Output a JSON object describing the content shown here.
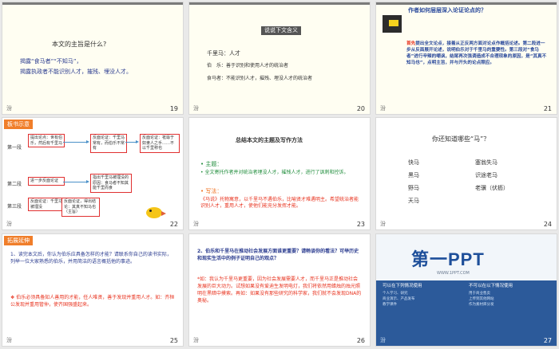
{
  "slides": [
    {
      "num": "19",
      "foot": "汾",
      "title": "本文的主旨是什么?",
      "lines": [
        "揭露“食马者”“不知马”，",
        "揭露执政者不能识别人才，摧残、埋没人才。"
      ]
    },
    {
      "num": "20",
      "foot": "汾",
      "title": "说说下文含义",
      "lines": [
        "千里马：人才",
        "伯　乐：善于识别和使用人才的统治者",
        "食马者：不能识别人才，摧残、埋没人才的统治者"
      ]
    },
    {
      "num": "21",
      "foot": "汾",
      "title": "作者如何层层深入论证论点的？",
      "body_lead": "首先",
      "body": "提出全文论点，接着从正反两方面对论点作概括论述。第二段进一步从反面展开论述，说明伯乐对于千里马的重要性。第三段对“食马者”进行辛辣的嘲讽，结尾再次强调造成不合理现象的原因，是“其真不知马也”，点明主旨，并与开头的论点照应。"
    },
    {
      "num": "22",
      "foot": "汾",
      "tag": "板书示意",
      "rows": [
        "第一段",
        "第二段",
        "第三段"
      ],
      "boxes": [
        "提出论点：世有伯乐，然后有千里马",
        "反面论证：千里马常有，而伯乐不常有",
        "反面论证：祇辱于奴隶人之手……不以千里称也",
        "进一步反面论证",
        "指出千里马被埋没的原因：食马者不知其能千里而食",
        "反面论证：千里马被埋没",
        "反面论证，得出结论：其真不知马也（主旨）"
      ]
    },
    {
      "num": "23",
      "foot": "汾",
      "title": "总结本文的主题及写作方法",
      "l1": "主题：",
      "l2": "全文寄托作者并对统治者埋没人才，摧残人才，进行了讽刺和控诉。",
      "l3": "写法：",
      "l4_lead": "《马说》托物寓意，",
      "l4": "以千里马不遇伯乐，比喻贤才难遇明主。希望统治者能识别人才，重用人才，使他们能充分发挥才能。"
    },
    {
      "num": "24",
      "foot": "汾",
      "title": "你还知道哪些“马”？",
      "col1": [
        "快马",
        "黑马",
        "野马",
        "天马"
      ],
      "col2": [
        "塞翁失马",
        "识途老马",
        "老骥（伏枥）"
      ]
    },
    {
      "num": "25",
      "foot": "汾",
      "tag": "拓展延伸",
      "q1": "1、读完本文后，你认为伯乐应具备怎样的才能？请联系你自己的读书实际，列举一位大家熟悉的伯乐，并用简洁的语言概括他的事迹。",
      "a1": "伯乐必须具备知人善用的才能，任人唯贤，善于发现并重用人才。如：齐桓公发现并重用管仲，使齐国强盛起来。"
    },
    {
      "num": "26",
      "foot": "汾",
      "q2": "2、伯乐和千里马在推动社会发展方面谁更重要？请畅谈你的看法？可举历史和现实生活中的例子证明自己的观点？",
      "a2": "*如：我认为千里马更重要，因为社会发展需要人才，而千里马正是推动社会发展的巨大动力。试想如果没有爱迪生发明电灯，我们将依然用蜡烛的烛光照明在黑暗中摸索。再如：如果没有那些研究的科学家，我们就不会发现DNA的奥秘。"
    },
    {
      "num": "27",
      "foot": "汾",
      "logo": "第一PPT",
      "url": "WWW.1PPT.COM",
      "left_head": "可以在下列情况使用",
      "right_head": "不可以在以下情况使用",
      "left_items": [
        "个人学习、研究",
        "商业演示、产品发布",
        "教学课件"
      ],
      "right_items": [
        "用于商业售卖",
        "上传到其他网站",
        "作为素材库分发"
      ]
    }
  ]
}
